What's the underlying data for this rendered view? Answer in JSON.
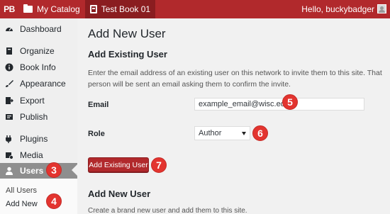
{
  "topbar": {
    "logo": "PB",
    "catalog": "My Catalog",
    "book": "Test Book 01",
    "greeting": "Hello, buckybadger"
  },
  "sidebar": {
    "items": [
      {
        "label": "Dashboard",
        "icon": "dashboard-icon"
      },
      {
        "label": "Organize",
        "icon": "book-icon"
      },
      {
        "label": "Book Info",
        "icon": "info-icon"
      },
      {
        "label": "Appearance",
        "icon": "brush-icon"
      },
      {
        "label": "Export",
        "icon": "export-icon"
      },
      {
        "label": "Publish",
        "icon": "publish-icon"
      },
      {
        "label": "Plugins",
        "icon": "plugin-icon"
      },
      {
        "label": "Media",
        "icon": "media-icon"
      },
      {
        "label": "Users",
        "icon": "user-icon"
      }
    ],
    "submenu": [
      "All Users",
      "Add New"
    ]
  },
  "main": {
    "page_title": "Add New User",
    "existing_title": "Add Existing User",
    "description": "Enter the email address of an existing user on this network to invite them to this site. That person will be sent an email asking them to confirm the invite.",
    "email_label": "Email",
    "email_value": "example_email@wisc.edu",
    "role_label": "Role",
    "role_value": "Author",
    "add_button": "Add Existing User",
    "new_title": "Add New User",
    "new_desc": "Create a brand new user and add them to this site."
  },
  "callouts": [
    "3",
    "4",
    "5",
    "6",
    "7"
  ],
  "colors": {
    "accent": "#b1292c",
    "badge": "#e3342f"
  }
}
